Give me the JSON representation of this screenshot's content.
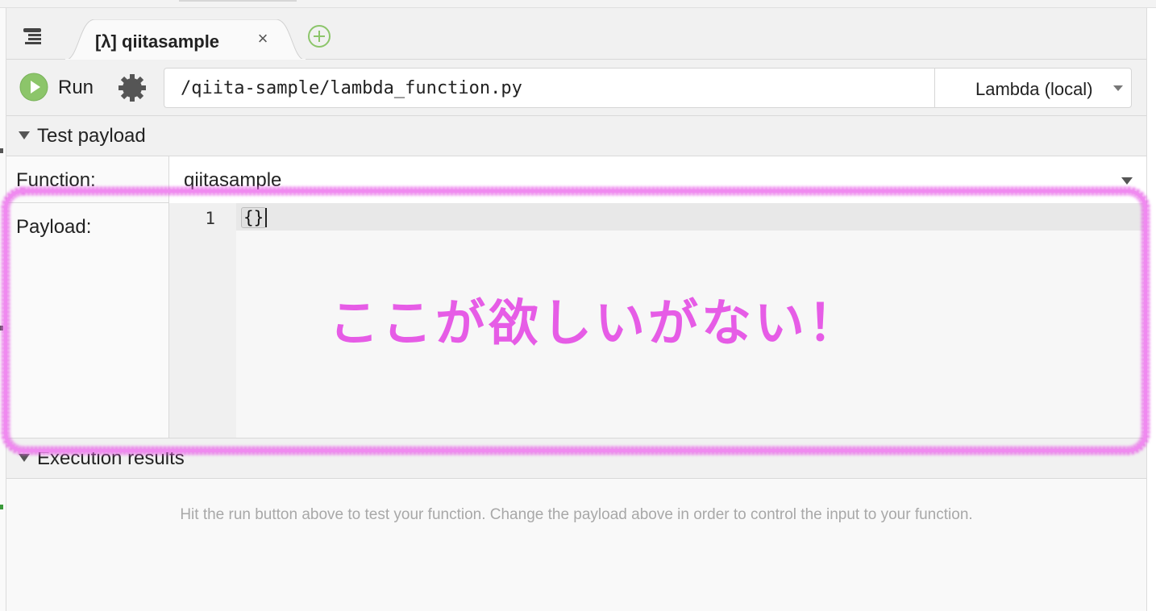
{
  "tabs": [
    {
      "title": "[λ] qiitasample",
      "active": true
    }
  ],
  "tab_close_symbol": "×",
  "icons": {
    "tabs_menu": "list-menu-icon",
    "add_tab": "plus-circle-icon",
    "run": "play-icon",
    "settings": "gear-icon",
    "tab_close": "close-icon",
    "dropdown": "chevron-down-icon"
  },
  "toolbar": {
    "run_label": "Run",
    "path_value": "/qiita-sample/lambda_function.py",
    "runtime_selected": "Lambda (local)"
  },
  "test_payload": {
    "header": "Test payload",
    "function_label": "Function:",
    "function_value": "qiitasample",
    "payload_label": "Payload:",
    "editor": {
      "line_number": "1",
      "code": "{}"
    }
  },
  "execution_results": {
    "header": "Execution results",
    "hint": "Hit the run button above to test your function. Change the payload above in order to control the input to your function."
  },
  "annotation": {
    "text": "ここが欲しいがない！",
    "color": "#e65ce6"
  },
  "colors": {
    "run_green": "#8cc56a",
    "add_tab_green": "#8cc56a",
    "chrome_bg": "#f1f1f1",
    "hint_gray": "#a8a8a8"
  }
}
